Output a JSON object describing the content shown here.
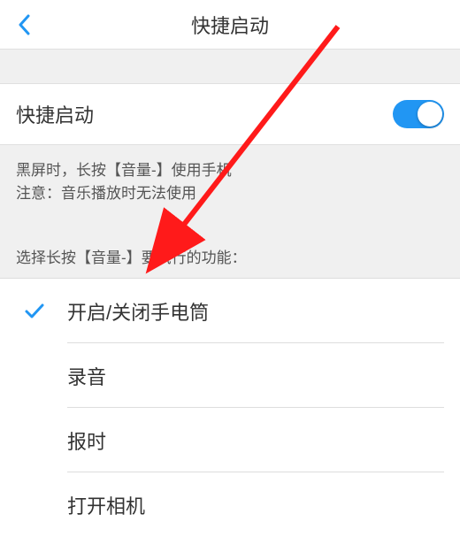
{
  "header": {
    "title": "快捷启动"
  },
  "toggle": {
    "label": "快捷启动",
    "enabled": true
  },
  "description": {
    "line1": "黑屏时，长按【音量-】使用手机",
    "line2": "注意：音乐播放时无法使用"
  },
  "section_hint": "选择长按【音量-】要执行的功能：",
  "options": [
    {
      "label": "开启/关闭手电筒",
      "selected": true
    },
    {
      "label": "录音",
      "selected": false
    },
    {
      "label": "报时",
      "selected": false
    },
    {
      "label": "打开相机",
      "selected": false
    }
  ],
  "colors": {
    "accent": "#2196f3",
    "arrow": "#ff1a1a"
  }
}
